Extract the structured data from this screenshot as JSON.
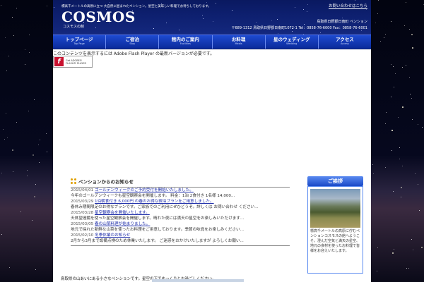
{
  "header": {
    "tagline": "標高千メートルの高原に立つ 大自然に囲まれたペンション。星空と美味しい料理でお待ちしております。",
    "logo": "COSMOS",
    "logo_sub": "コスモスの館",
    "top_link": "お問い合わせはこちら",
    "address_line1": "鳥取県日野郡日南町 ペンション",
    "address_line2": "〒689-1312 鳥取県日野郡日南町1072-1 Tel：0858-76-6000 Fax：0858-76-6001"
  },
  "nav": [
    {
      "jp": "トップページ",
      "en": "Top Page"
    },
    {
      "jp": "ご宿泊",
      "en": "Stay"
    },
    {
      "jp": "館内のご案内",
      "en": "Facilities"
    },
    {
      "jp": "お料理",
      "en": "Meals"
    },
    {
      "jp": "星のウェディング",
      "en": "Wedding"
    },
    {
      "jp": "アクセス",
      "en": "Access"
    }
  ],
  "flash": {
    "message": "このコンテンツを表示するには Adobe Flash Player の最新バージョンが必要です。",
    "badge_line1": "Get ADOBE®",
    "badge_line2": "FLASH® PLAYER",
    "badge_letter": "f"
  },
  "news": {
    "title": "ペンションからのお知らせ",
    "entries": [
      {
        "date": "2015/04/01",
        "link": "ゴールデンウィークのご予約受付を開始いたしました。",
        "body": "今年のゴールデンウィークも星空観察会を開催します。 料金：1泊 2食付き 1名様 14,000..."
      },
      {
        "date": "2015/03/29",
        "link": "1泊朝食付き 6,000円 の春のお得な宿泊プランをご用意しました。",
        "body": "春休み期間限定のお得なプランです。ご家族でのご利用にぜひどうぞ。詳しくは お問い合わせ ください..."
      },
      {
        "date": "2015/03/28",
        "link": "星空観察会を開催いたします。",
        "body": "天体望遠鏡を使った星空観察会を開催します。晴れた夜には満天の星空をお楽しみいただけます..."
      },
      {
        "date": "2015/03/05",
        "link": "春の山菜料理が始まりました。",
        "body": "地元で採れた新鮮な山菜を使ったお料理をご用意しております。季節の味覚をお楽しみください..."
      },
      {
        "date": "2015/02/10",
        "link": "冬季休業のお知らせ",
        "body": "2月から3月まで設備点検のため休業いたします。 ご迷惑をおかけいたしますが よろしくお願い..."
      }
    ]
  },
  "greeting": {
    "title": "ご挨拶",
    "text": "標高千メートルの高原に佇むペンションコスモスの館へようこそ。澄んだ空気と満天の星空、地元の食材を使ったお料理で皆様をお迎えいたします。"
  },
  "bottom_text": "鳥取県の山あいにある小さなペンションです。星空の下でゆっくりとお過ごしください。"
}
